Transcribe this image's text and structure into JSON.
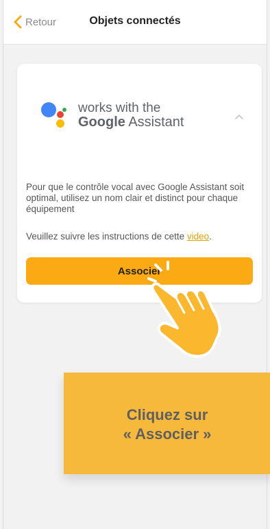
{
  "header": {
    "back_label": "Retour",
    "title": "Objets connectés"
  },
  "card": {
    "logo": {
      "line1": "works with the",
      "line2_bold": "Google",
      "line2_rest": " Assistant"
    },
    "description": "Pour que le contrôle vocal avec Google Assistant soit optimal, utilisez un nom clair et distinct pour chaque équipement",
    "instructions_prefix": "Veuillez suivre les instructions de cette ",
    "instructions_link": "video",
    "instructions_suffix": ".",
    "button_label": "Associer"
  },
  "callout": {
    "line1": "Cliquez sur",
    "line2": "« Associer »"
  },
  "colors": {
    "accent": "#fbaa14",
    "callout": "#f6b93c",
    "link": "#e6a100"
  }
}
